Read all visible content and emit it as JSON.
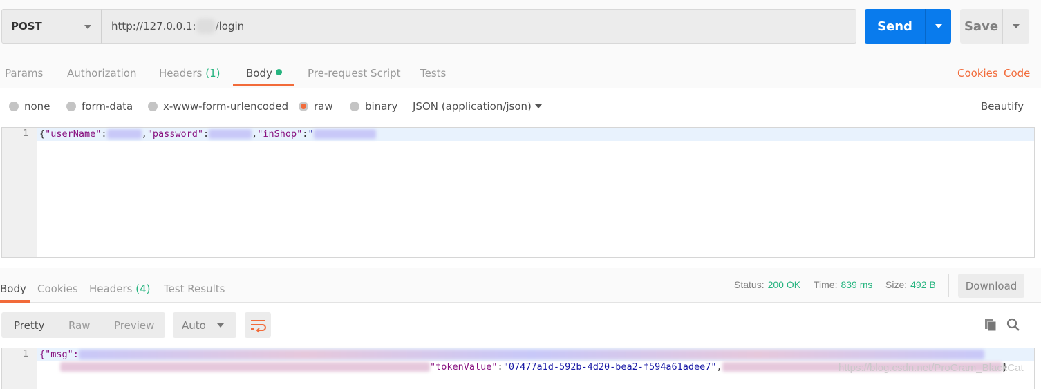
{
  "request": {
    "method": "POST",
    "url_prefix": "http://127.0.0.1:",
    "url_suffix": "/login",
    "send_label": "Send",
    "save_label": "Save"
  },
  "request_tabs": {
    "items": [
      {
        "label": "Params"
      },
      {
        "label": "Authorization"
      },
      {
        "label": "Headers",
        "count": "(1)"
      },
      {
        "label": "Body",
        "active": true
      },
      {
        "label": "Pre-request Script"
      },
      {
        "label": "Tests"
      }
    ],
    "cookies": "Cookies",
    "code": "Code"
  },
  "body_types": {
    "options": [
      "none",
      "form-data",
      "x-www-form-urlencoded",
      "raw",
      "binary"
    ],
    "selected": "raw",
    "format": "JSON (application/json)",
    "beautify": "Beautify"
  },
  "request_body": {
    "line_number": "1",
    "k_open": "{",
    "k_user": "\"userName\"",
    "colon": ":",
    "comma": ",",
    "k_pass": "\"password\"",
    "k_shop": "\"inShop\"",
    "quote": "\""
  },
  "response_tabs": {
    "items": [
      "Body",
      "Cookies",
      "Headers",
      "Test Results"
    ],
    "headers_count": "(4)"
  },
  "response_meta": {
    "status_label": "Status:",
    "status": "200 OK",
    "time_label": "Time:",
    "time": "839 ms",
    "size_label": "Size:",
    "size": "492 B",
    "download": "Download"
  },
  "view_modes": {
    "items": [
      "Pretty",
      "Raw",
      "Preview"
    ],
    "selected": "Pretty",
    "format": "Auto"
  },
  "response_body": {
    "line_number": "1",
    "msg_key": "{\"msg\":",
    "token_key": "\"tokenValue\"",
    "token_value": "\"07477a1d-592b-4d20-bea2-f594a61adee7\"",
    "close": "}"
  },
  "watermark": "https://blog.csdn.net/ProGram_BlackCat",
  "colors": {
    "accent": "#f26b3a",
    "send": "#097bed",
    "success": "#26b47f"
  }
}
